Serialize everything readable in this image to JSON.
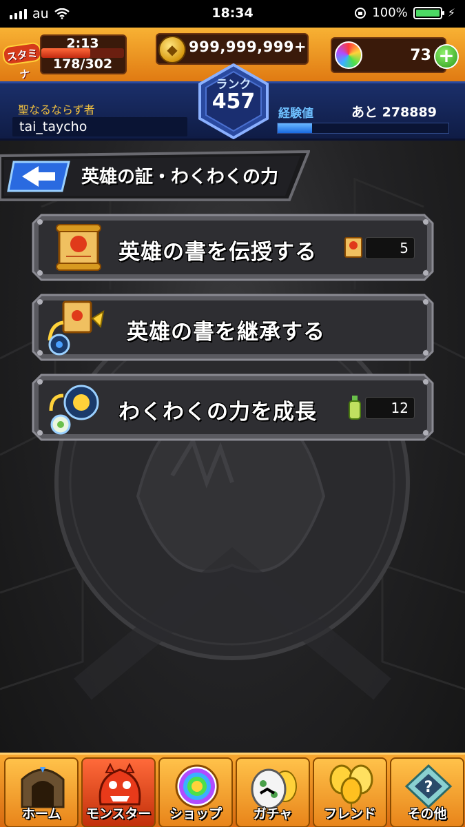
{
  "status_bar": {
    "carrier": "au",
    "time": "18:34",
    "battery_percent": "100%",
    "battery_level": 1.0
  },
  "hud": {
    "stamina_label": "スタミナ",
    "stamina_timer": "2:13",
    "stamina_count": "178/302",
    "stamina_level": 0.59,
    "coins": "999,999,999+",
    "orbs": "73",
    "orb_add": "+",
    "rank_label": "ランク",
    "rank_value": "457",
    "title": "聖なるならず者",
    "user_name": "tai_taycho",
    "exp_label": "経験値",
    "exp_remaining": "あと 278889",
    "exp_level": 0.2
  },
  "section": {
    "title": "英雄の証・わくわくの力"
  },
  "menu": [
    {
      "label": "英雄の書を伝授する",
      "count": "5",
      "icon": "scroll-icon",
      "item_icon": "small-scroll-icon"
    },
    {
      "label": "英雄の書を継承する",
      "count": "",
      "icon": "scroll-transfer-icon",
      "item_icon": ""
    },
    {
      "label": "わくわくの力を成長",
      "count": "12",
      "icon": "waku-orb-icon",
      "item_icon": "growth-potion-icon"
    }
  ],
  "nav": [
    {
      "label": "ホーム",
      "icon": "home-gate-icon"
    },
    {
      "label": "モンスター",
      "icon": "monster-icon"
    },
    {
      "label": "ショップ",
      "icon": "rainbow-orb-icon"
    },
    {
      "label": "ガチャ",
      "icon": "egg-icon"
    },
    {
      "label": "フレンド",
      "icon": "friend-balloons-icon"
    },
    {
      "label": "その他",
      "icon": "other-icon"
    }
  ],
  "colors": {
    "hud_orange": "#f8b234",
    "hud_blue": "#1b2f6a",
    "button_frame": "#6a6a70",
    "button_face": "#2e2e32",
    "nav_orange": "#f8a830"
  }
}
